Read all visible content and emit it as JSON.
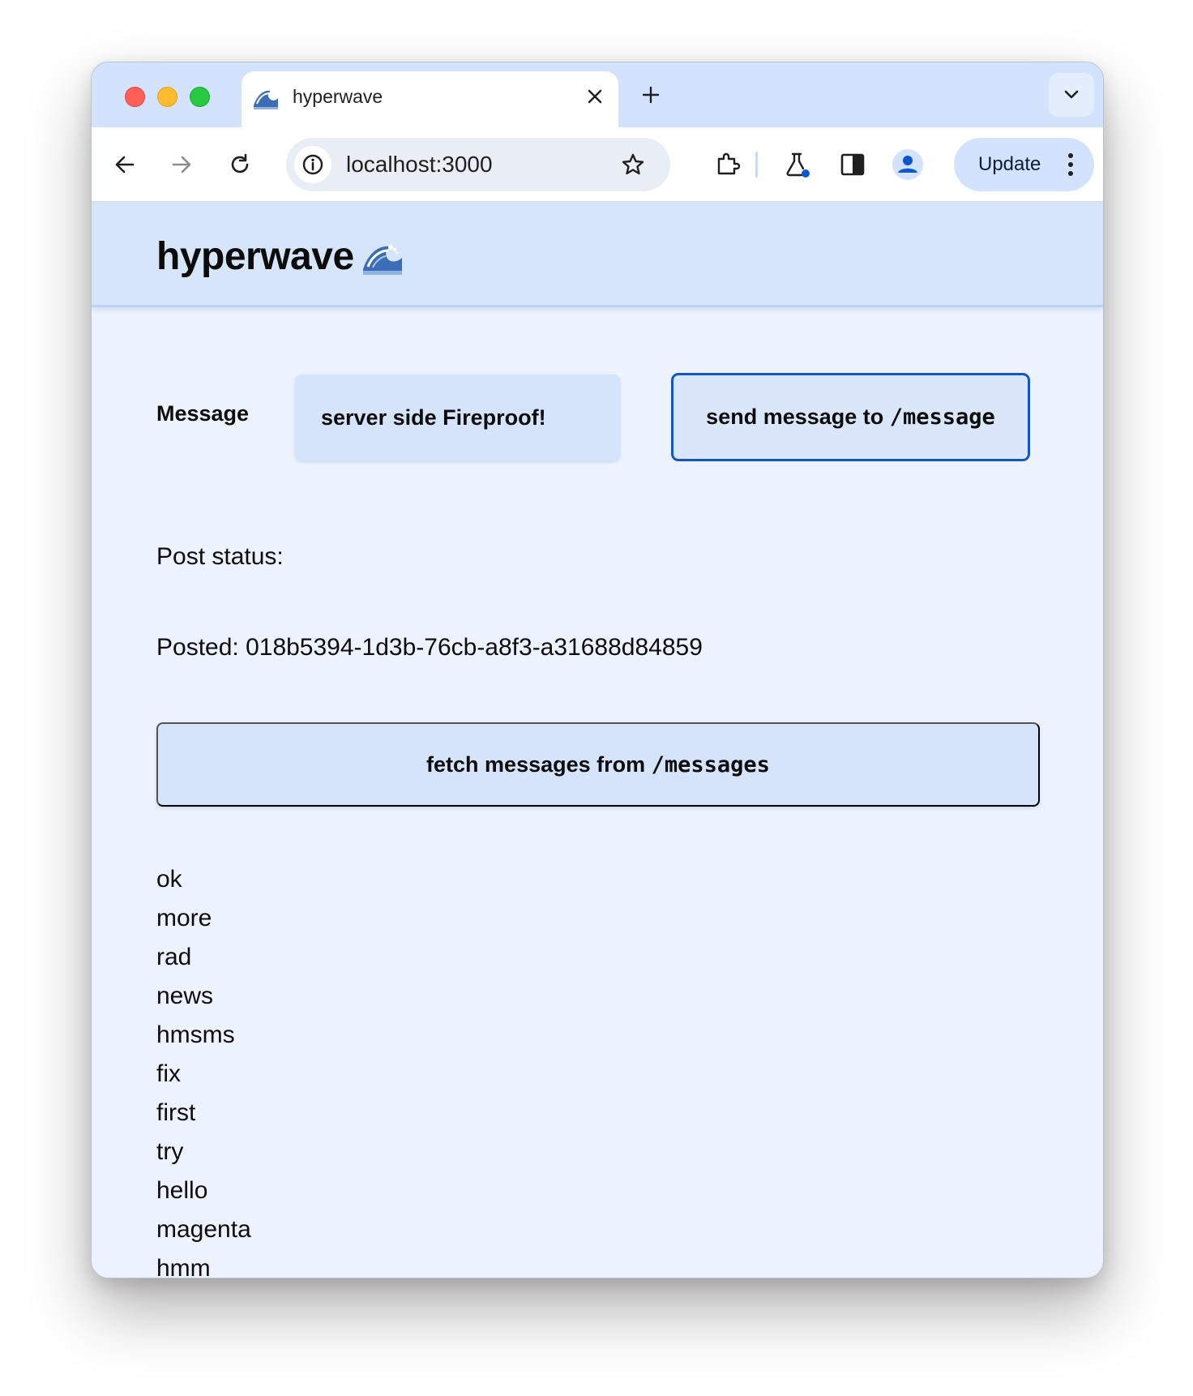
{
  "browser": {
    "tab_title": "hyperwave",
    "url": "localhost:3000",
    "update_label": "Update"
  },
  "page": {
    "site_title": "hyperwave",
    "message_label": "Message",
    "message_value": "server side Fireproof!",
    "send_button": {
      "text": "send message to ",
      "code": "/message"
    },
    "post_status_label": "Post status:",
    "posted_text": "Posted: 018b5394-1d3b-76cb-a8f3-a31688d84859",
    "fetch_button": {
      "text": "fetch messages from ",
      "code": "/messages"
    },
    "messages": [
      "ok",
      "more",
      "rad",
      "news",
      "hmsms",
      "fix",
      "first",
      "try",
      "hello",
      "magenta",
      "hmm"
    ]
  },
  "colors": {
    "tabstrip": "#d3e3fd",
    "page_bg": "#edf3fe",
    "header_bg": "#d7e5fb",
    "button_bg": "#d6e4fb",
    "focus_border": "#1356c8"
  }
}
